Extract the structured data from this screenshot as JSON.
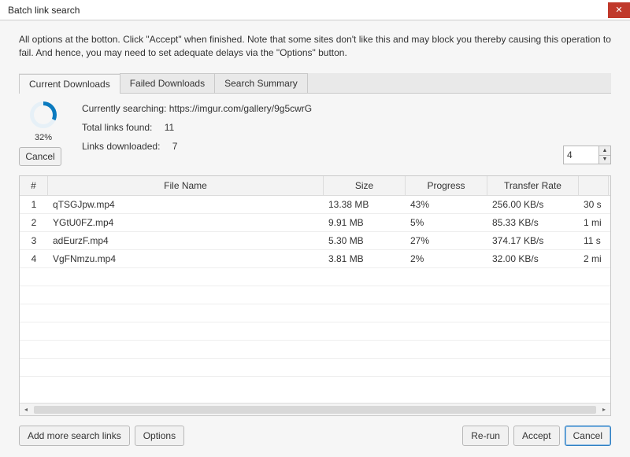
{
  "title": "Batch link search",
  "instructions": "All options at the botton. Click \"Accept\" when finished. Note that some sites don't like this and may block you thereby causing this operation to fail. And hence, you may need to set adequate delays via the \"Options\" button.",
  "tabs": [
    {
      "label": "Current Downloads"
    },
    {
      "label": "Failed Downloads"
    },
    {
      "label": "Search Summary"
    }
  ],
  "active_tab": 0,
  "progress": {
    "pct_label": "32%",
    "pct_value": 32,
    "searching_label": "Currently searching:",
    "searching_value": "https://imgur.com/gallery/9g5cwrG",
    "total_label": "Total links found:",
    "total_value": "11",
    "downloaded_label": "Links downloaded:",
    "downloaded_value": "7"
  },
  "cancel_label": "Cancel",
  "spinner_value": "4",
  "columns": {
    "idx": "#",
    "name": "File Name",
    "size": "Size",
    "prog": "Progress",
    "rate": "Transfer Rate"
  },
  "rows": [
    {
      "idx": "1",
      "name": "qTSGJpw.mp4",
      "size": "13.38 MB",
      "prog": "43%",
      "rate": "256.00 KB/s",
      "time": "30 s"
    },
    {
      "idx": "2",
      "name": "YGtU0FZ.mp4",
      "size": "9.91 MB",
      "prog": "5%",
      "rate": "85.33 KB/s",
      "time": "1 mi"
    },
    {
      "idx": "3",
      "name": "adEurzF.mp4",
      "size": "5.30 MB",
      "prog": "27%",
      "rate": "374.17 KB/s",
      "time": "11 s"
    },
    {
      "idx": "4",
      "name": "VgFNmzu.mp4",
      "size": "3.81 MB",
      "prog": "2%",
      "rate": "32.00 KB/s",
      "time": "2 mi"
    }
  ],
  "buttons": {
    "add_links": "Add more search links",
    "options": "Options",
    "rerun": "Re-run",
    "accept": "Accept",
    "cancel": "Cancel"
  }
}
